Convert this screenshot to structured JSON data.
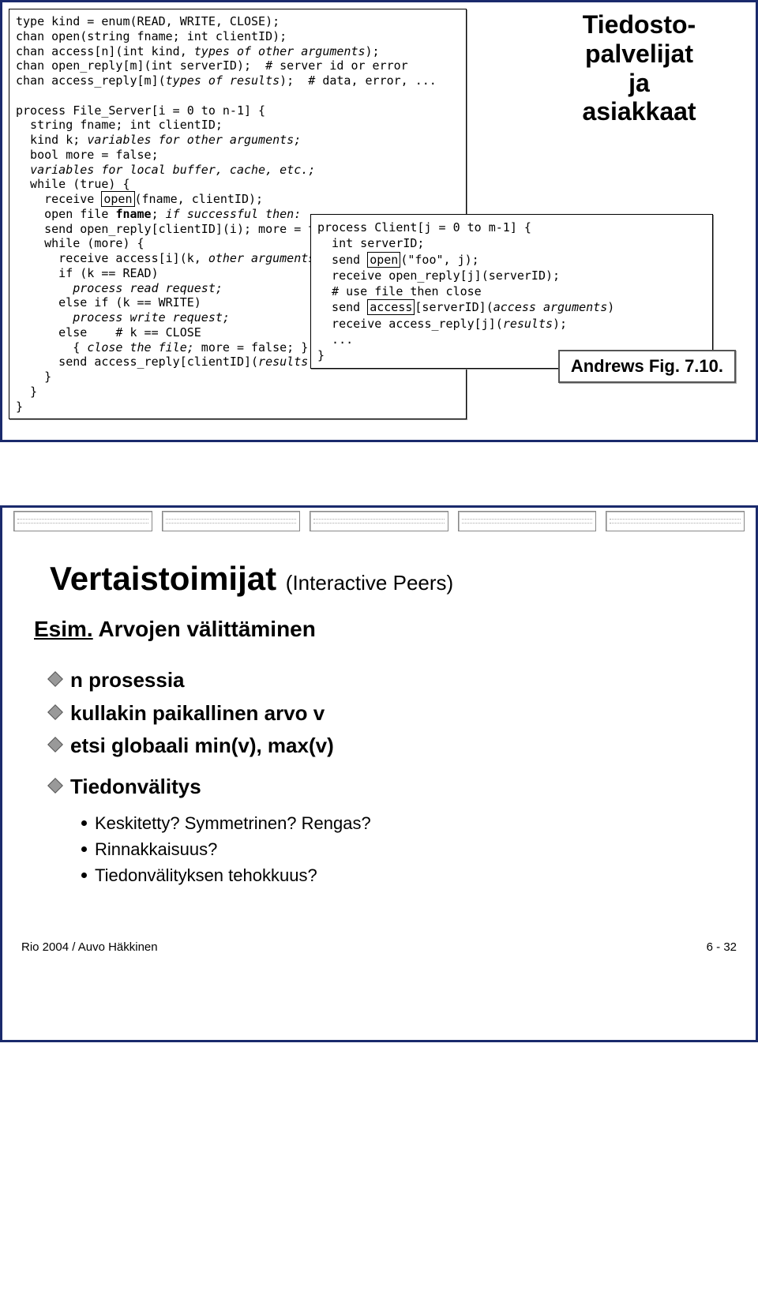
{
  "slide1": {
    "side_title": "Tiedosto-\npalvelijat\nja\nasiakkaat",
    "figref": "Andrews Fig. 7.10.",
    "server_code_html": "type kind = enum(READ, WRITE, CLOSE);\nchan open(string fname; int clientID);\nchan access[n](int kind, <i>types of other arguments</i>);\nchan open_reply[m](int serverID);  # server id or error\nchan access_reply[m](<i>types of results</i>);  # data, error, ...\n\nprocess File_Server[i = 0 to n-1] {\n  string fname; int clientID;\n  kind k; <i>variables for other arguments;</i>\n  bool more = false;\n  <i>variables for local buffer, cache, etc.;</i>\n  while (true) {\n    receive <span class=\"boxed\">open</span>(fname, clientID);\n    open file <b>fname</b>; <i>if successful then:</i>\n    send open_reply[clientID](i); more = true;\n    while (more) {\n      receive access[i](k, <i>other arguments</i>\n      if (k == READ)\n        <i>process read request;</i>\n      else if (k == WRITE)\n        <i>process write request;</i>\n      else    # k == CLOSE\n        { <i>close the file;</i> more = false; }\n      send access_reply[clientID](<i>results</i>\n    }\n  }\n}",
    "client_code_html": "process Client[j = 0 to m-1] {\n  int serverID;\n  send <span class=\"boxed\">open</span>(\"foo\", j);\n  receive open_reply[j](serverID);\n  # use file then close\n  send <span class=\"boxed\">access</span>[serverID](<i>access arguments</i>)\n  receive access_reply[j](<i>results</i>);\n  ...\n}"
  },
  "slide2": {
    "title_main": "Vertaistoimijat",
    "title_sub": "(Interactive Peers)",
    "esim_label": "Esim.",
    "esim_text": "Arvojen välittäminen",
    "bullets": [
      "n prosessia",
      "kullakin paikallinen arvo v",
      "etsi globaali min(v), max(v)",
      "Tiedonvälitys"
    ],
    "sub_bullets": [
      "Keskitetty? Symmetrinen? Rengas?",
      "Rinnakkaisuus?",
      "Tiedonvälityksen tehokkuus?"
    ],
    "footer_left": "Rio 2004 / Auvo Häkkinen",
    "footer_right": "6 - 32"
  }
}
